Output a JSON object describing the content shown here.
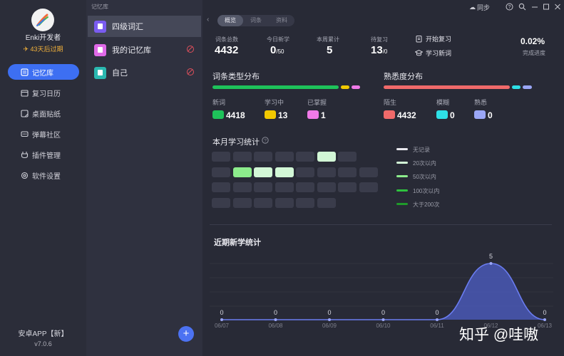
{
  "user": {
    "name": "Enki开发者",
    "expiry": "43天后过期"
  },
  "nav": [
    {
      "label": "记忆库",
      "icon": "memory-icon",
      "active": true
    },
    {
      "label": "复习日历",
      "icon": "calendar-icon",
      "active": false
    },
    {
      "label": "桌面贴纸",
      "icon": "sticker-icon",
      "active": false
    },
    {
      "label": "弹幕社区",
      "icon": "danmaku-icon",
      "active": false
    },
    {
      "label": "插件管理",
      "icon": "plugin-icon",
      "active": false
    },
    {
      "label": "软件设置",
      "icon": "gear-icon",
      "active": false
    }
  ],
  "footer": {
    "app_link": "安卓APP【新】",
    "version": "v7.0.6"
  },
  "library": {
    "header": "记忆库",
    "items": [
      {
        "name": "四级词汇",
        "color": "#7a5cf0"
      },
      {
        "name": "我的记忆库",
        "color": "#e06ae8"
      },
      {
        "name": "自己",
        "color": "#2ab8b0"
      }
    ]
  },
  "tabs": [
    "概览",
    "词条",
    "资料"
  ],
  "window": {
    "sync_label": "同步"
  },
  "stats": {
    "total_label": "词条总数",
    "total_value": "4432",
    "today_label": "今日新学",
    "today_value": "0",
    "today_goal": "/50",
    "week_label": "本周累计",
    "week_value": "5",
    "review_label": "待复习",
    "review_value": "13",
    "review_goal": "/0",
    "start_review": "开始复习",
    "learn_new": "学习新词",
    "progress_value": "0.02%",
    "progress_label": "完成进度"
  },
  "type_dist": {
    "title": "词条类型分布",
    "items": [
      {
        "label": "新词",
        "value": "4418",
        "color": "#1ec25a"
      },
      {
        "label": "学习中",
        "value": "13",
        "color": "#f2c900"
      },
      {
        "label": "已掌握",
        "value": "1",
        "color": "#f07ae8"
      }
    ]
  },
  "familiarity": {
    "title": "熟悉度分布",
    "items": [
      {
        "label": "陌生",
        "value": "4432",
        "color": "#f06a6a"
      },
      {
        "label": "模糊",
        "value": "0",
        "color": "#2ee0e6"
      },
      {
        "label": "熟悉",
        "value": "0",
        "color": "#9aa6f6"
      }
    ]
  },
  "month": {
    "title": "本月学习统计",
    "legend": [
      "无记录",
      "20次以内",
      "50次以内",
      "100次以内",
      "大于200次"
    ],
    "legend_colors": [
      "#e8e8ee",
      "#d2f7d6",
      "#8cec8c",
      "#2ec23e",
      "#1f9a2a"
    ]
  },
  "recent_chart": {
    "title": "近期新学统计",
    "chart_data": {
      "type": "area",
      "categories": [
        "06/07",
        "06/08",
        "06/09",
        "06/10",
        "06/11",
        "06/12",
        "06/13"
      ],
      "values": [
        0,
        0,
        0,
        0,
        0,
        5,
        0
      ],
      "data_labels": [
        "0",
        "0",
        "0",
        "0",
        "0",
        "5",
        "0"
      ]
    }
  },
  "watermark": "知乎 @哇嗷"
}
